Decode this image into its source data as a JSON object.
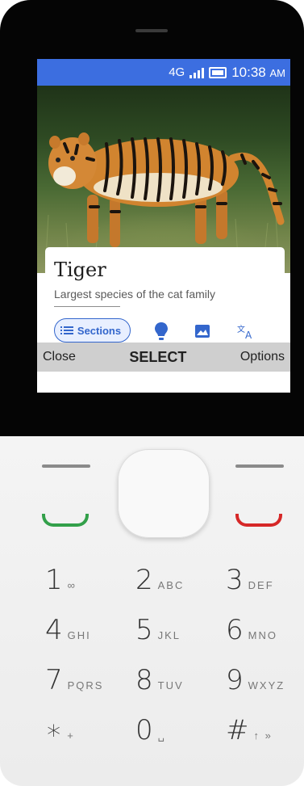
{
  "status_bar": {
    "network": "4G",
    "time": "10:38",
    "ampm": "AM"
  },
  "article": {
    "title": "Tiger",
    "description": "Largest species of the cat family",
    "sections_label": "Sections"
  },
  "softkeys": {
    "left": "Close",
    "center": "SELECT",
    "right": "Options"
  },
  "keypad": [
    {
      "digit": "1",
      "letters": "∞"
    },
    {
      "digit": "2",
      "letters": "ABC"
    },
    {
      "digit": "3",
      "letters": "DEF"
    },
    {
      "digit": "4",
      "letters": "GHI"
    },
    {
      "digit": "5",
      "letters": "JKL"
    },
    {
      "digit": "6",
      "letters": "MNO"
    },
    {
      "digit": "7",
      "letters": "PQRS"
    },
    {
      "digit": "8",
      "letters": "TUV"
    },
    {
      "digit": "9",
      "letters": "WXYZ"
    },
    {
      "digit": "∗",
      "letters": "+"
    },
    {
      "digit": "0",
      "letters": "␣"
    },
    {
      "digit": "#",
      "letters": "↑ »"
    }
  ],
  "colors": {
    "status_bar": "#3c6ee0",
    "accent": "#3366cc",
    "call": "#33a04a",
    "end": "#d62828"
  }
}
